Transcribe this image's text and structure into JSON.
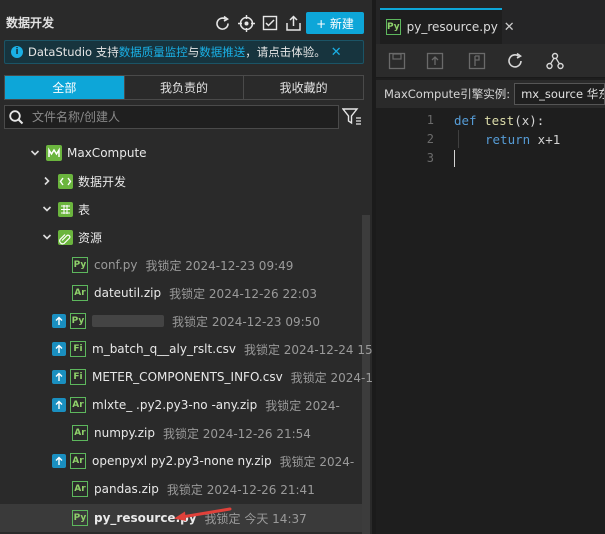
{
  "left": {
    "title": "数据开发",
    "new_button": "+ 新建",
    "banner": {
      "prefix": "DataStudio 支持",
      "link1": "数据质量监控",
      "mid": "与",
      "link2": "数据推送",
      "suffix": "，请点击体验。",
      "close": "✕"
    },
    "tabs": [
      "全部",
      "我负责的",
      "我收藏的"
    ],
    "active_tab": "全部",
    "search_placeholder": "文件名称/创建人",
    "tree": {
      "root": "MaxCompute",
      "folders": [
        "数据开发",
        "表",
        "资源"
      ],
      "files": [
        {
          "badge": "Py",
          "name": "conf.py",
          "meta": "我锁定  2024-12-23 09:49"
        },
        {
          "badge": "Ar",
          "name": "dateutil.zip",
          "meta": "我锁定  2024-12-26 22:03"
        },
        {
          "badge": "Py",
          "name": "",
          "meta": "我锁定  2024-12-23 09:50"
        },
        {
          "badge": "Fi",
          "name": "m_batch_q__aly_rslt.csv",
          "meta": "我锁定  2024-12-24 15:47"
        },
        {
          "badge": "Fi",
          "name": "METER_COMPONENTS_INFO.csv",
          "meta": "我锁定  2024-12-"
        },
        {
          "badge": "Ar",
          "name": "mlxte_ .py2.py3-no  -any.zip",
          "meta": "我锁定  2024-"
        },
        {
          "badge": "Ar",
          "name": "numpy.zip",
          "meta": "我锁定  2024-12-26 21:54"
        },
        {
          "badge": "Ar",
          "name": "openpyxl  py2.py3-none  ny.zip",
          "meta": "我锁定  2024-"
        },
        {
          "badge": "Ar",
          "name": "pandas.zip",
          "meta": "我锁定  2024-12-26 21:41"
        },
        {
          "badge": "Py",
          "name": "py_resource.py",
          "meta": "我锁定  今天 14:37"
        }
      ]
    }
  },
  "editor": {
    "tab_label": "py_resource.py",
    "tab_badge": "Py",
    "engine_label": "MaxCompute引擎实例:",
    "engine_value": "mx_source 华东",
    "line_numbers": [
      "1",
      "2",
      "3"
    ],
    "code": {
      "l1_kw": "def",
      "l1_fn": "test",
      "l1_rest": "(x):",
      "l2_kw": "return",
      "l2_rest": " x+1"
    }
  },
  "colors": {
    "accent": "#0da6d8",
    "badge_green": "#5db75d",
    "annotation_arrow": "#e0413a"
  },
  "icons": [
    "refresh-icon",
    "locate-icon",
    "checklist-icon",
    "import-icon",
    "search-icon",
    "filter-icon",
    "save-icon",
    "submit-icon",
    "deploy-icon",
    "lineage-icon"
  ]
}
